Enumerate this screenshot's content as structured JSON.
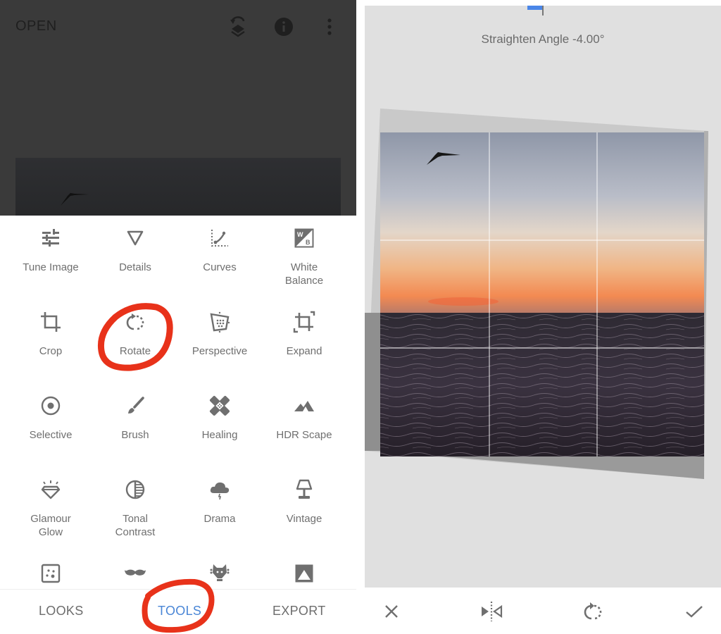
{
  "left_panel": {
    "header": {
      "open_label": "OPEN",
      "icons": [
        "undo-layers-icon",
        "info-icon",
        "more-vert-icon"
      ]
    },
    "tools": [
      {
        "label": "Tune Image",
        "icon": "tune-sliders-icon"
      },
      {
        "label": "Details",
        "icon": "details-triangle-icon"
      },
      {
        "label": "Curves",
        "icon": "curves-icon"
      },
      {
        "label": "White Balance",
        "icon": "white-balance-icon"
      },
      {
        "label": "Crop",
        "icon": "crop-icon"
      },
      {
        "label": "Rotate",
        "icon": "rotate-icon"
      },
      {
        "label": "Perspective",
        "icon": "perspective-icon"
      },
      {
        "label": "Expand",
        "icon": "expand-icon"
      },
      {
        "label": "Selective",
        "icon": "selective-target-icon"
      },
      {
        "label": "Brush",
        "icon": "brush-icon"
      },
      {
        "label": "Healing",
        "icon": "healing-bandage-icon"
      },
      {
        "label": "HDR Scape",
        "icon": "mountains-icon"
      },
      {
        "label": "Glamour Glow",
        "icon": "diamond-glow-icon"
      },
      {
        "label": "Tonal Contrast",
        "icon": "tonal-contrast-icon"
      },
      {
        "label": "Drama",
        "icon": "storm-cloud-icon"
      },
      {
        "label": "Vintage",
        "icon": "lamp-icon"
      },
      {
        "label": "",
        "icon": "grainy-film-icon"
      },
      {
        "label": "",
        "icon": "mustache-icon"
      },
      {
        "label": "",
        "icon": "guitar-head-icon"
      },
      {
        "label": "",
        "icon": "frames-icon"
      }
    ],
    "bottom_nav": [
      {
        "label": "LOOKS",
        "active": false
      },
      {
        "label": "TOOLS",
        "active": true
      },
      {
        "label": "EXPORT",
        "active": false
      }
    ],
    "highlighted": [
      "Rotate",
      "TOOLS"
    ]
  },
  "right_panel": {
    "angle_label": "Straighten Angle -4.00°",
    "straighten_angle_deg": -4.0,
    "actions": [
      {
        "name": "cancel",
        "icon": "close-icon"
      },
      {
        "name": "flip-horizontal",
        "icon": "flip-horizontal-icon"
      },
      {
        "name": "rotate-90",
        "icon": "rotate-icon"
      },
      {
        "name": "apply",
        "icon": "check-icon"
      }
    ]
  },
  "colors": {
    "accent_blue": "#4a86d6",
    "annotation_red": "#e8321a",
    "icon_gray": "#6f6f6f",
    "dark_header": "#3a3a3a",
    "canvas_gray": "#e0e0e0"
  }
}
